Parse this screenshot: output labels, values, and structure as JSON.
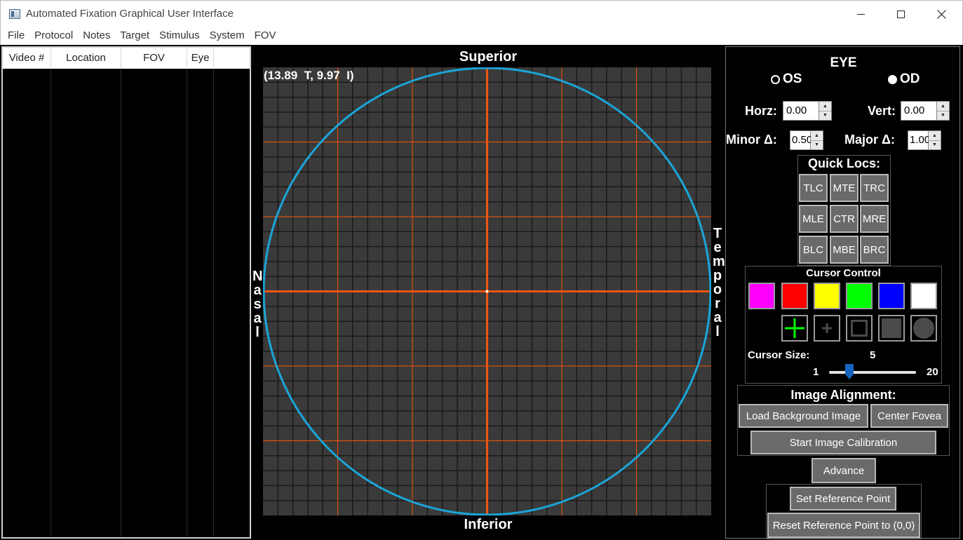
{
  "window": {
    "title": "Automated Fixation Graphical User Interface",
    "minimize": "—",
    "maximize": "☐",
    "close": "✕"
  },
  "menu": [
    "File",
    "Protocol",
    "Notes",
    "Target",
    "Stimulus",
    "System",
    "FOV"
  ],
  "table": {
    "columns": [
      "Video #",
      "Location",
      "FOV",
      "Eye"
    ],
    "rows": []
  },
  "grid": {
    "superior": "Superior",
    "inferior": "Inferior",
    "nasal": "N\na\ns\na\nl",
    "temporal": "T\ne\nm\np\no\nr\na\nl",
    "coordinate": "(13.89  T, 9.97  I)",
    "colors": {
      "background": "#3a3a3a",
      "minor_grid": "#1a1a1a",
      "major_grid": "#e05a14",
      "axis": "#f05510",
      "circle": "#1ba5d8"
    }
  },
  "controls": {
    "eye_label": "EYE",
    "eye_options": [
      {
        "label": "OS",
        "selected": false
      },
      {
        "label": "OD",
        "selected": true
      }
    ],
    "horz_label": "Horz:",
    "horz_value": "0.00",
    "vert_label": "Vert:",
    "vert_value": "0.00",
    "minor_label": "Minor Δ:",
    "minor_value": "0.50",
    "major_label": "Major Δ:",
    "major_value": "1.00",
    "quick_locs_label": "Quick Locs:",
    "quick_locs": [
      "TLC",
      "MTE",
      "TRC",
      "MLE",
      "CTR",
      "MRE",
      "BLC",
      "MBE",
      "BRC"
    ],
    "cursor_control_label": "Cursor Control",
    "cursor_colors": [
      "#ff00ff",
      "#ff0000",
      "#ffff00",
      "#00ff00",
      "#0000ff",
      "#ffffff"
    ],
    "cursor_shapes": [
      "large-cross",
      "small-cross",
      "hollow-square",
      "filled-square",
      "filled-circle"
    ],
    "cursor_size_label": "Cursor Size:",
    "cursor_size_value": "5",
    "cursor_size_min": "1",
    "cursor_size_max": "20",
    "image_alignment_label": "Image Alignment:",
    "load_bg_button": "Load Background Image",
    "center_fovea_button": "Center Fovea",
    "start_calibration_button": "Start Image Calibration",
    "advance_button": "Advance",
    "set_ref_button": "Set Reference Point",
    "reset_ref_button": "Reset Reference Point to (0,0)"
  }
}
